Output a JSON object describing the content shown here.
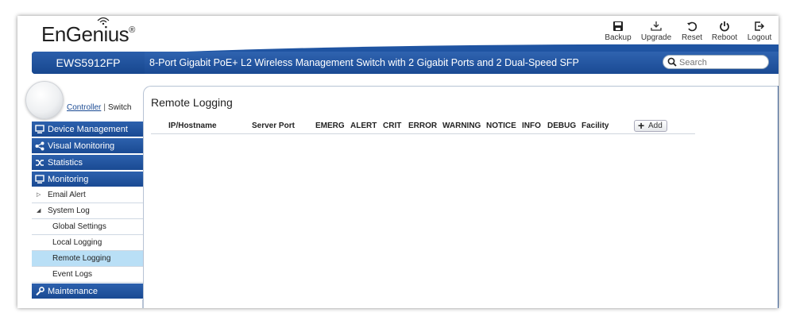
{
  "header": {
    "logo_text": "EnGenius",
    "logo_mark": "®",
    "tools": [
      {
        "label": "Backup",
        "icon": "save-icon"
      },
      {
        "label": "Upgrade",
        "icon": "download-icon"
      },
      {
        "label": "Reset",
        "icon": "reset-icon"
      },
      {
        "label": "Reboot",
        "icon": "power-icon"
      },
      {
        "label": "Logout",
        "icon": "logout-icon"
      }
    ],
    "model": "EWS5912FP",
    "model_description": "8-Port Gigabit PoE+ L2 Wireless Management Switch with 2 Gigabit Ports and 2 Dual-Speed SFP",
    "search_placeholder": "Search"
  },
  "sidebar": {
    "controller_label": "Controller",
    "separator": "|",
    "switch_label": "Switch",
    "sections": {
      "device_management": "Device Management",
      "visual_monitoring": "Visual Monitoring",
      "statistics": "Statistics",
      "monitoring": "Monitoring",
      "email_alert": "Email Alert",
      "system_log": "System Log",
      "global_settings": "Global Settings",
      "local_logging": "Local Logging",
      "remote_logging": "Remote Logging",
      "event_logs": "Event Logs",
      "maintenance": "Maintenance"
    }
  },
  "main": {
    "title": "Remote Logging",
    "columns": [
      "IP/Hostname",
      "Server Port",
      "EMERG",
      "ALERT",
      "CRIT",
      "ERROR",
      "WARNING",
      "NOTICE",
      "INFO",
      "DEBUG",
      "Facility"
    ],
    "add_label": "Add"
  },
  "colors": {
    "brand_blue": "#1a4a93",
    "active_item": "#b9dff6"
  }
}
